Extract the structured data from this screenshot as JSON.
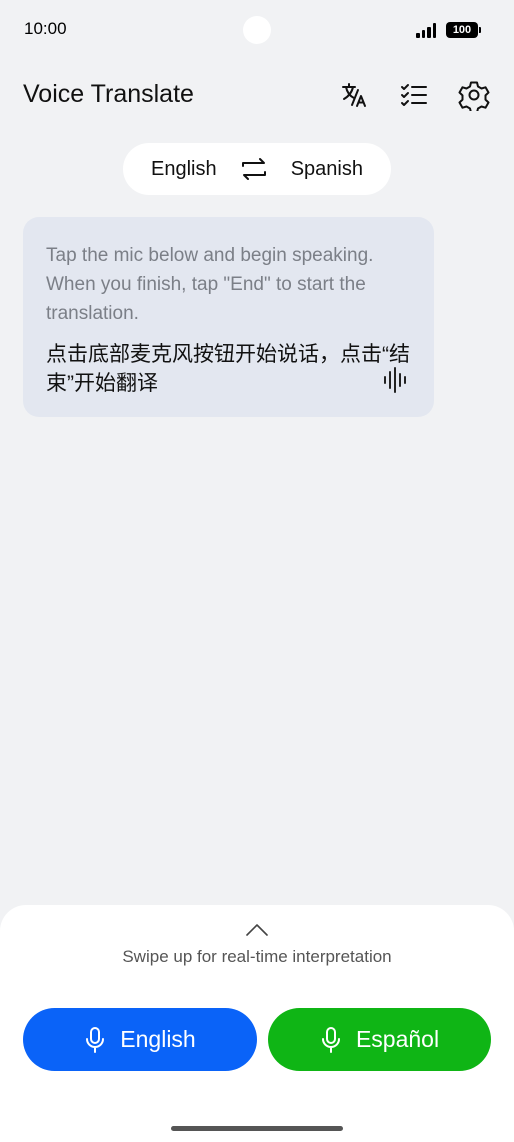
{
  "status_bar": {
    "time": "10:00",
    "battery": "100"
  },
  "header": {
    "title": "Voice Translate",
    "icons": [
      "translate-icon",
      "history-list-icon",
      "settings-gear-icon"
    ]
  },
  "language_pair": {
    "source": "English",
    "target": "Spanish",
    "swap_icon": "swap-arrows-icon"
  },
  "card": {
    "hint_en": "Tap the mic below and begin speaking. When you finish, tap \"End\" to start the translation.",
    "hint_zh": "点击底部麦克风按钮开始说话，点击“结束”开始翻译",
    "icon": "sound-wave-icon"
  },
  "bottom_sheet": {
    "swipe_hint": "Swipe up for real-time interpretation",
    "mic_left_label": "English",
    "mic_right_label": "Español",
    "colors": {
      "left": "#0a63f8",
      "right": "#0fb515"
    }
  }
}
